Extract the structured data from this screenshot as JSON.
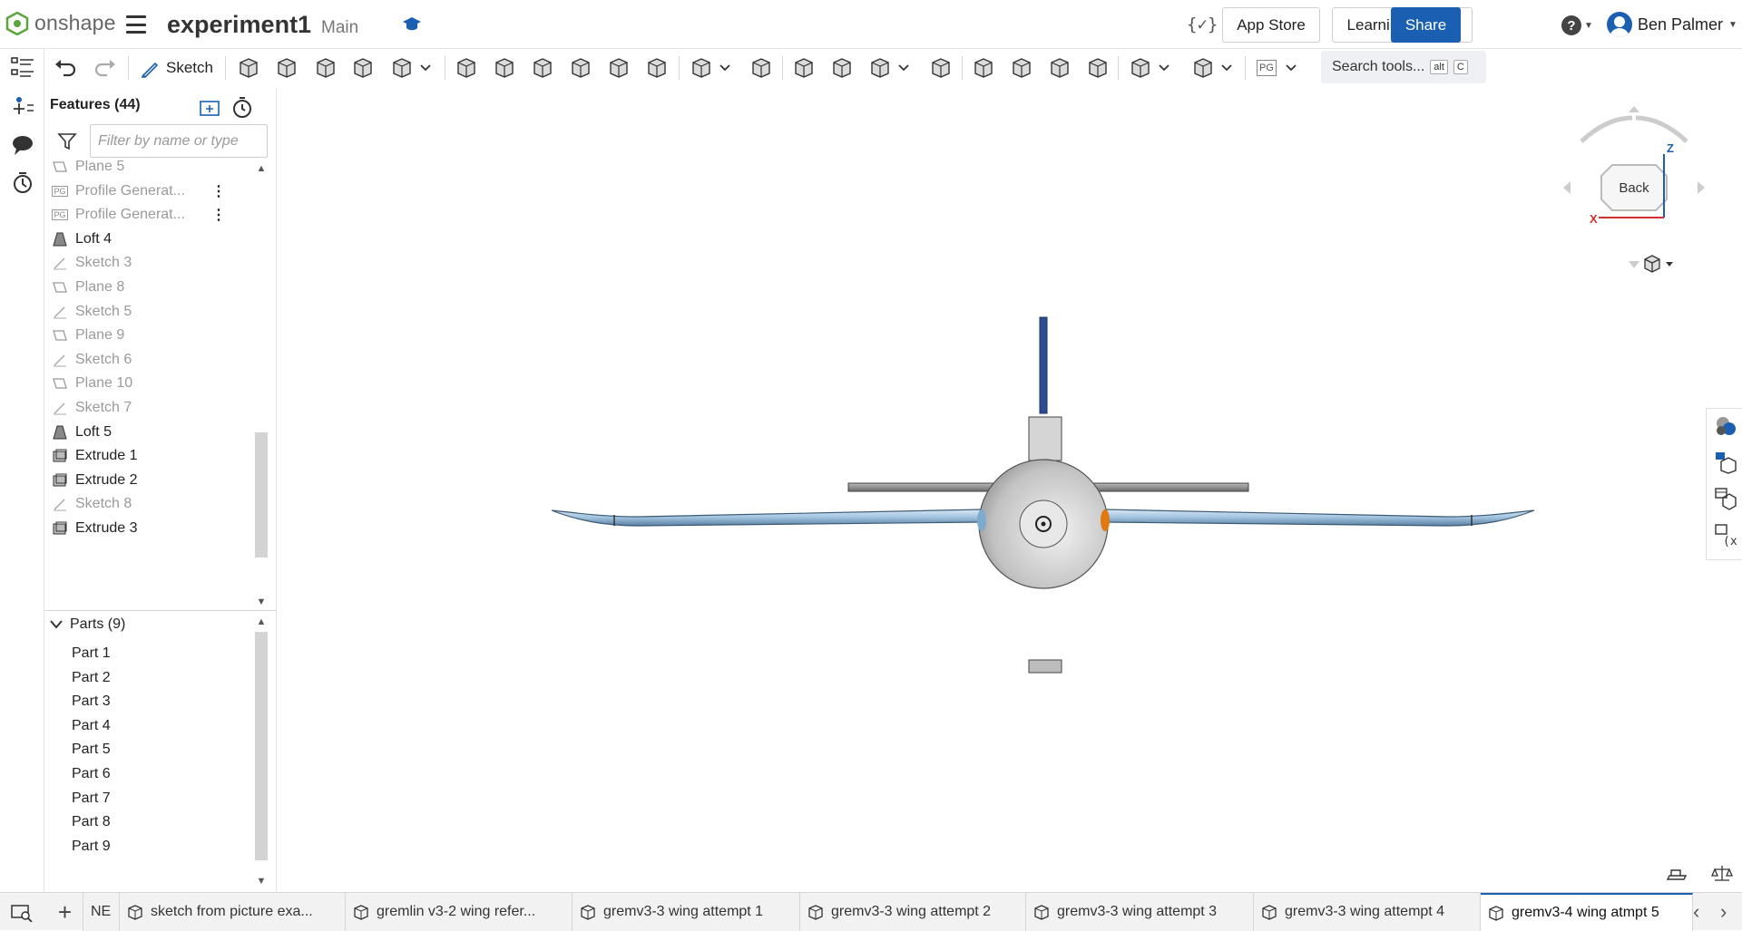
{
  "app": {
    "logo_text": "onshape",
    "doc_title": "experiment1",
    "branch": "Main"
  },
  "header": {
    "var_icon": "{✓}",
    "app_store": "App Store",
    "learning_center": "Learning Center",
    "share": "Share",
    "help": "?",
    "user_name": "Ben Palmer"
  },
  "toolbar": {
    "sketch_label": "Sketch",
    "pg_label": "PG",
    "search_label": "Search tools...",
    "kbd1": "alt",
    "kbd2": "C"
  },
  "features": {
    "header": "Features (44)",
    "filter_placeholder": "Filter by name or type",
    "items": [
      {
        "label": "Plane 5",
        "icon": "plane-icon",
        "dim": true
      },
      {
        "label": "Profile Generat...",
        "icon": "pg-icon",
        "dim": true,
        "pg": "PG"
      },
      {
        "label": "Profile Generat...",
        "icon": "pg-icon",
        "dim": true,
        "pg": "PG"
      },
      {
        "label": "Loft 4",
        "icon": "loft-icon",
        "dim": false
      },
      {
        "label": "Sketch 3",
        "icon": "sketch-icon",
        "dim": true
      },
      {
        "label": "Plane 8",
        "icon": "plane-icon",
        "dim": true
      },
      {
        "label": "Sketch 5",
        "icon": "sketch-icon",
        "dim": true
      },
      {
        "label": "Plane 9",
        "icon": "plane-icon",
        "dim": true
      },
      {
        "label": "Sketch 6",
        "icon": "sketch-icon",
        "dim": true
      },
      {
        "label": "Plane 10",
        "icon": "plane-icon",
        "dim": true
      },
      {
        "label": "Sketch 7",
        "icon": "sketch-icon",
        "dim": true
      },
      {
        "label": "Loft 5",
        "icon": "loft-icon",
        "dim": false
      },
      {
        "label": "Extrude 1",
        "icon": "extrude-icon",
        "dim": false
      },
      {
        "label": "Extrude 2",
        "icon": "extrude-icon",
        "dim": false
      },
      {
        "label": "Sketch 8",
        "icon": "sketch-icon",
        "dim": true
      },
      {
        "label": "Extrude 3",
        "icon": "extrude-icon",
        "dim": false
      }
    ]
  },
  "parts": {
    "header": "Parts (9)",
    "items": [
      "Part 1",
      "Part 2",
      "Part 3",
      "Part 4",
      "Part 5",
      "Part 6",
      "Part 7",
      "Part 8",
      "Part 9"
    ]
  },
  "viewcube": {
    "face": "Back",
    "axis_z": "Z",
    "axis_x": "X"
  },
  "tabs": [
    {
      "label": "NE",
      "active": false
    },
    {
      "label": "sketch from picture exa...",
      "active": false
    },
    {
      "label": "gremlin v3-2 wing refer...",
      "active": false
    },
    {
      "label": "gremv3-3 wing attempt 1",
      "active": false
    },
    {
      "label": "gremv3-3 wing attempt 2",
      "active": false
    },
    {
      "label": "gremv3-3 wing attempt 3",
      "active": false
    },
    {
      "label": "gremv3-3 wing attempt 4",
      "active": false
    },
    {
      "label": "gremv3-4 wing atmpt 5",
      "active": true
    }
  ],
  "colors": {
    "accent": "#1b5fb3",
    "wing": "#a9c8e2",
    "body": "#c8c8c8",
    "fin": "#2a4a8a"
  }
}
